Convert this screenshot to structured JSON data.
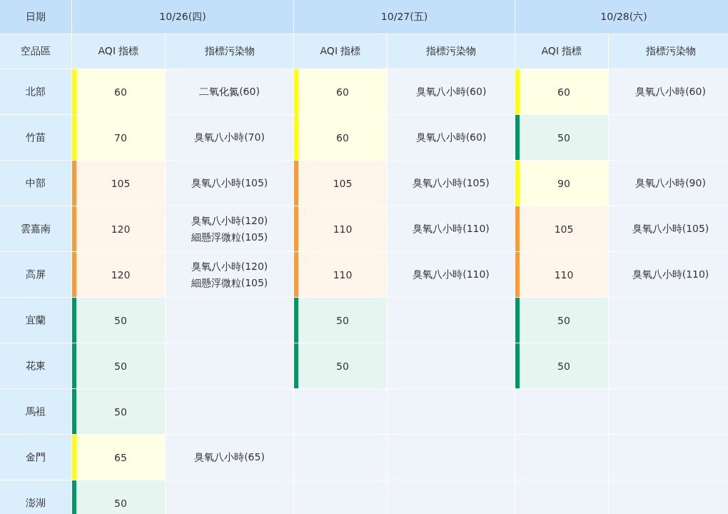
{
  "table": {
    "corner_label": "日期",
    "region_label": "空品區",
    "dates": [
      {
        "label": "10/26(四)",
        "aqi_label": "AQI 指標",
        "pollutant_label": "指標污染物"
      },
      {
        "label": "10/27(五)",
        "aqi_label": "AQI 指標",
        "pollutant_label": "指標污染物"
      },
      {
        "label": "10/28(六)",
        "aqi_label": "AQI 指標",
        "pollutant_label": "指標污染物"
      }
    ],
    "rows": [
      {
        "region": "北部",
        "days": [
          {
            "aqi": "60",
            "color": "#ffff00",
            "pollutants": [
              "二氧化氮(60)"
            ]
          },
          {
            "aqi": "60",
            "color": "#ffff00",
            "pollutants": [
              "臭氧八小時(60)"
            ]
          },
          {
            "aqi": "60",
            "color": "#ffff00",
            "pollutants": [
              "臭氧八小時(60)"
            ]
          }
        ]
      },
      {
        "region": "竹苗",
        "days": [
          {
            "aqi": "70",
            "color": "#ffff00",
            "pollutants": [
              "臭氧八小時(70)"
            ]
          },
          {
            "aqi": "60",
            "color": "#ffff00",
            "pollutants": [
              "臭氧八小時(60)"
            ]
          },
          {
            "aqi": "50",
            "color": "#009966"
          }
        ]
      },
      {
        "region": "中部",
        "days": [
          {
            "aqi": "105",
            "color": "#ff9933",
            "pollutants": [
              "臭氧八小時(105)"
            ]
          },
          {
            "aqi": "105",
            "color": "#ff9933",
            "pollutants": [
              "臭氧八小時(105)"
            ]
          },
          {
            "aqi": "90",
            "color": "#ffff00",
            "pollutants": [
              "臭氧八小時(90)"
            ]
          }
        ]
      },
      {
        "region": "雲嘉南",
        "days": [
          {
            "aqi": "120",
            "color": "#ff9933",
            "pollutants": [
              "臭氧八小時(120)",
              "細懸浮微粒(105)"
            ]
          },
          {
            "aqi": "110",
            "color": "#ff9933",
            "pollutants": [
              "臭氧八小時(110)"
            ]
          },
          {
            "aqi": "105",
            "color": "#ff9933",
            "pollutants": [
              "臭氧八小時(105)"
            ]
          }
        ]
      },
      {
        "region": "高屏",
        "days": [
          {
            "aqi": "120",
            "color": "#ff9933",
            "pollutants": [
              "臭氧八小時(120)",
              "細懸浮微粒(105)"
            ]
          },
          {
            "aqi": "110",
            "color": "#ff9933",
            "pollutants": [
              "臭氧八小時(110)"
            ]
          },
          {
            "aqi": "110",
            "color": "#ff9933",
            "pollutants": [
              "臭氧八小時(110)"
            ]
          }
        ]
      },
      {
        "region": "宜蘭",
        "days": [
          {
            "aqi": "50",
            "color": "#009966"
          },
          {
            "aqi": "50",
            "color": "#009966"
          },
          {
            "aqi": "50",
            "color": "#009966"
          }
        ]
      },
      {
        "region": "花東",
        "days": [
          {
            "aqi": "50",
            "color": "#009966"
          },
          {
            "aqi": "50",
            "color": "#009966"
          },
          {
            "aqi": "50",
            "color": "#009966"
          }
        ]
      },
      {
        "region": "馬祖",
        "days": [
          {
            "aqi": "50",
            "color": "#009966"
          }
        ]
      },
      {
        "region": "金門",
        "days": [
          {
            "aqi": "65",
            "color": "#ffff00",
            "pollutants": [
              "臭氧八小時(65)"
            ]
          }
        ]
      },
      {
        "region": "澎湖",
        "days": [
          {
            "aqi": "50",
            "color": "#009966"
          }
        ]
      }
    ]
  }
}
